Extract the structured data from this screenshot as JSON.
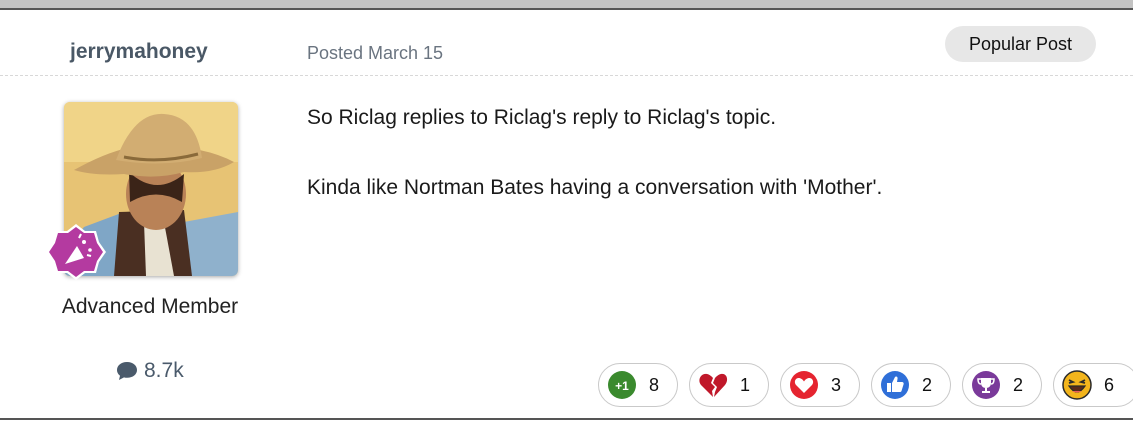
{
  "post": {
    "author": "jerrymahoney",
    "posted": "Posted March 15",
    "badge": "Popular Post",
    "member_title": "Advanced Member",
    "post_count": "8.7k",
    "body": [
      "So Riclag replies to Riclag's reply to Riclag's topic.",
      "Kinda like Nortman Bates having a conversation with 'Mother'."
    ]
  },
  "reactions": [
    {
      "icon": "plus-one-icon",
      "color": "#3a8a2e",
      "count": "8"
    },
    {
      "icon": "broken-heart-icon",
      "color": "#c0182a",
      "count": "1"
    },
    {
      "icon": "heart-icon",
      "color": "#e52430",
      "count": "3"
    },
    {
      "icon": "thumbs-up-icon",
      "color": "#2f6fd8",
      "count": "2"
    },
    {
      "icon": "trophy-icon",
      "color": "#7a3a9a",
      "count": "2"
    },
    {
      "icon": "laughing-face-icon",
      "color": "#f3b51c",
      "count": "6"
    }
  ]
}
